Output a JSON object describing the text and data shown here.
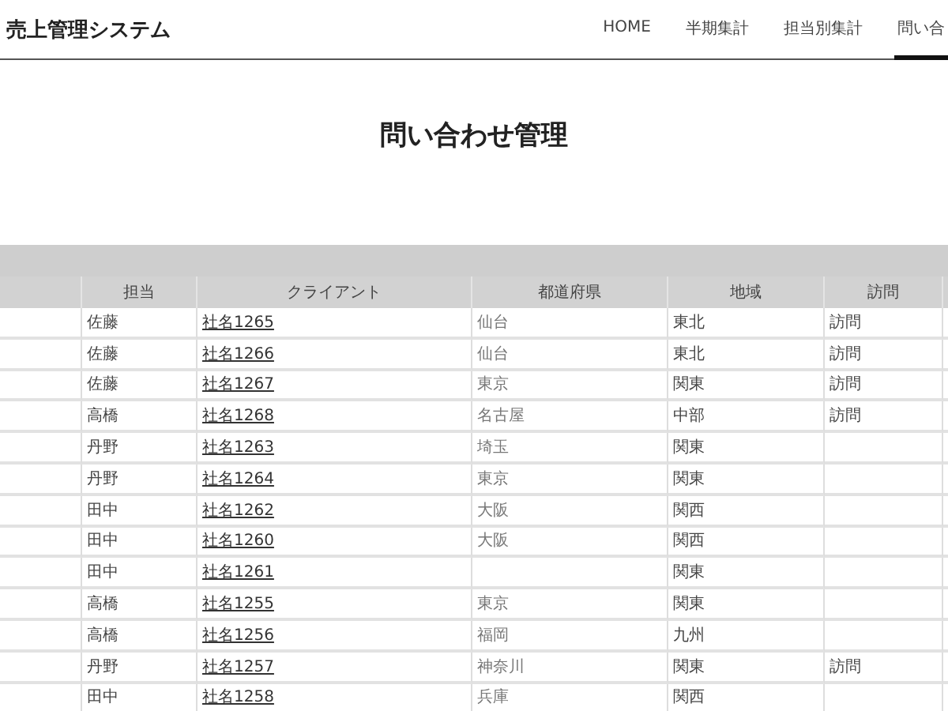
{
  "header": {
    "title": "売上管理システム",
    "nav": [
      {
        "label": "HOME",
        "selected": false
      },
      {
        "label": "半期集計",
        "selected": false
      },
      {
        "label": "担当別集計",
        "selected": false
      },
      {
        "label": "問い合",
        "selected": true
      }
    ]
  },
  "page_title": "問い合わせ管理",
  "table": {
    "columns": [
      "担当",
      "クライアント",
      "都道府県",
      "地域",
      "訪問"
    ],
    "rows": [
      {
        "staff": "佐藤",
        "client": "社名1265",
        "prefecture": "仙台",
        "region": "東北",
        "visit": "訪問"
      },
      {
        "staff": "佐藤",
        "client": "社名1266",
        "prefecture": "仙台",
        "region": "東北",
        "visit": "訪問"
      },
      {
        "staff": "佐藤",
        "client": "社名1267",
        "prefecture": "東京",
        "region": "関東",
        "visit": "訪問"
      },
      {
        "staff": "高橋",
        "client": "社名1268",
        "prefecture": "名古屋",
        "region": "中部",
        "visit": "訪問"
      },
      {
        "staff": "丹野",
        "client": "社名1263",
        "prefecture": "埼玉",
        "region": "関東"
      },
      {
        "staff": "丹野",
        "client": "社名1264",
        "prefecture": "東京",
        "region": "関東"
      },
      {
        "staff": "田中",
        "client": "社名1262",
        "prefecture": "大阪",
        "region": "関西"
      },
      {
        "staff": "田中",
        "client": "社名1260",
        "prefecture": "大阪",
        "region": "関西"
      },
      {
        "staff": "田中",
        "client": "社名1261",
        "region": "関東"
      },
      {
        "staff": "高橋",
        "client": "社名1255",
        "prefecture": "東京",
        "region": "関東"
      },
      {
        "staff": "高橋",
        "client": "社名1256",
        "prefecture": "福岡",
        "region": "九州"
      },
      {
        "staff": "丹野",
        "client": "社名1257",
        "prefecture": "神奈川",
        "region": "関東",
        "visit": "訪問"
      },
      {
        "staff": "田中",
        "client": "社名1258",
        "prefecture": "兵庫",
        "region": "関西"
      }
    ]
  }
}
